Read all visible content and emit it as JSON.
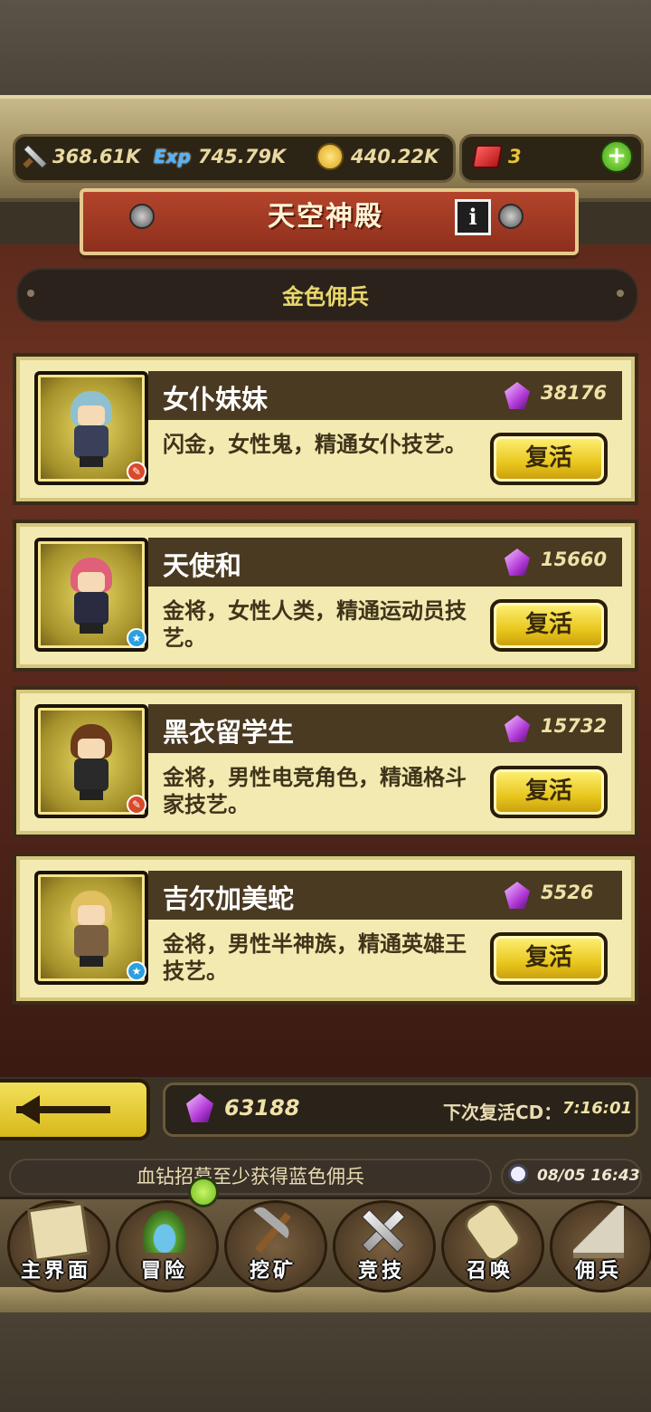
{
  "currencies": {
    "attack": "368.61K",
    "exp_label": "Exp",
    "exp": "745.79K",
    "gold": "440.22K",
    "ruby": "3"
  },
  "header": {
    "title": "天空神殿",
    "subtitle": "金色佣兵"
  },
  "mercenaries": [
    {
      "name": "女仆妹妹",
      "price": "38176",
      "desc": "闪金，女性鬼，精通女仆技艺。",
      "button": "复活",
      "badge": "red",
      "hair": "#8fc0d0",
      "outfit": "#3a3f5a"
    },
    {
      "name": "天使和",
      "price": "15660",
      "desc": "金将，女性人类，精通运动员技艺。",
      "button": "复活",
      "badge": "blue",
      "hair": "#e0607a",
      "outfit": "#2a2a40"
    },
    {
      "name": "黑衣留学生",
      "price": "15732",
      "desc": "金将，男性电竞角色，精通格斗家技艺。",
      "button": "复活",
      "badge": "red",
      "hair": "#6a3a1a",
      "outfit": "#2a2a2a"
    },
    {
      "name": "吉尔加美蛇",
      "price": "5526",
      "desc": "金将，男性半神族，精通英雄王技艺。",
      "button": "复活",
      "badge": "blue",
      "hair": "#e0c060",
      "outfit": "#7a6040"
    }
  ],
  "footer": {
    "gems": "63188",
    "cd_label": "下次复活CD：",
    "cd_value": "7:16:01",
    "ticker": "血钻招募至少获得蓝色佣兵",
    "datetime": "08/05 16:43"
  },
  "nav": [
    {
      "label": "主界面",
      "icon": "map-icon"
    },
    {
      "label": "冒险",
      "icon": "island-icon"
    },
    {
      "label": "挖矿",
      "icon": "pickaxe-icon"
    },
    {
      "label": "竞技",
      "icon": "crossed-swords-icon"
    },
    {
      "label": "召唤",
      "icon": "scroll-icon"
    },
    {
      "label": "佣兵",
      "icon": "tent-icon"
    }
  ],
  "colors": {
    "card_bg": "#f3eab2",
    "button_gold": "#e8c61c",
    "banner_red": "#b4442b",
    "subtitle_gold": "#e8d76a"
  }
}
